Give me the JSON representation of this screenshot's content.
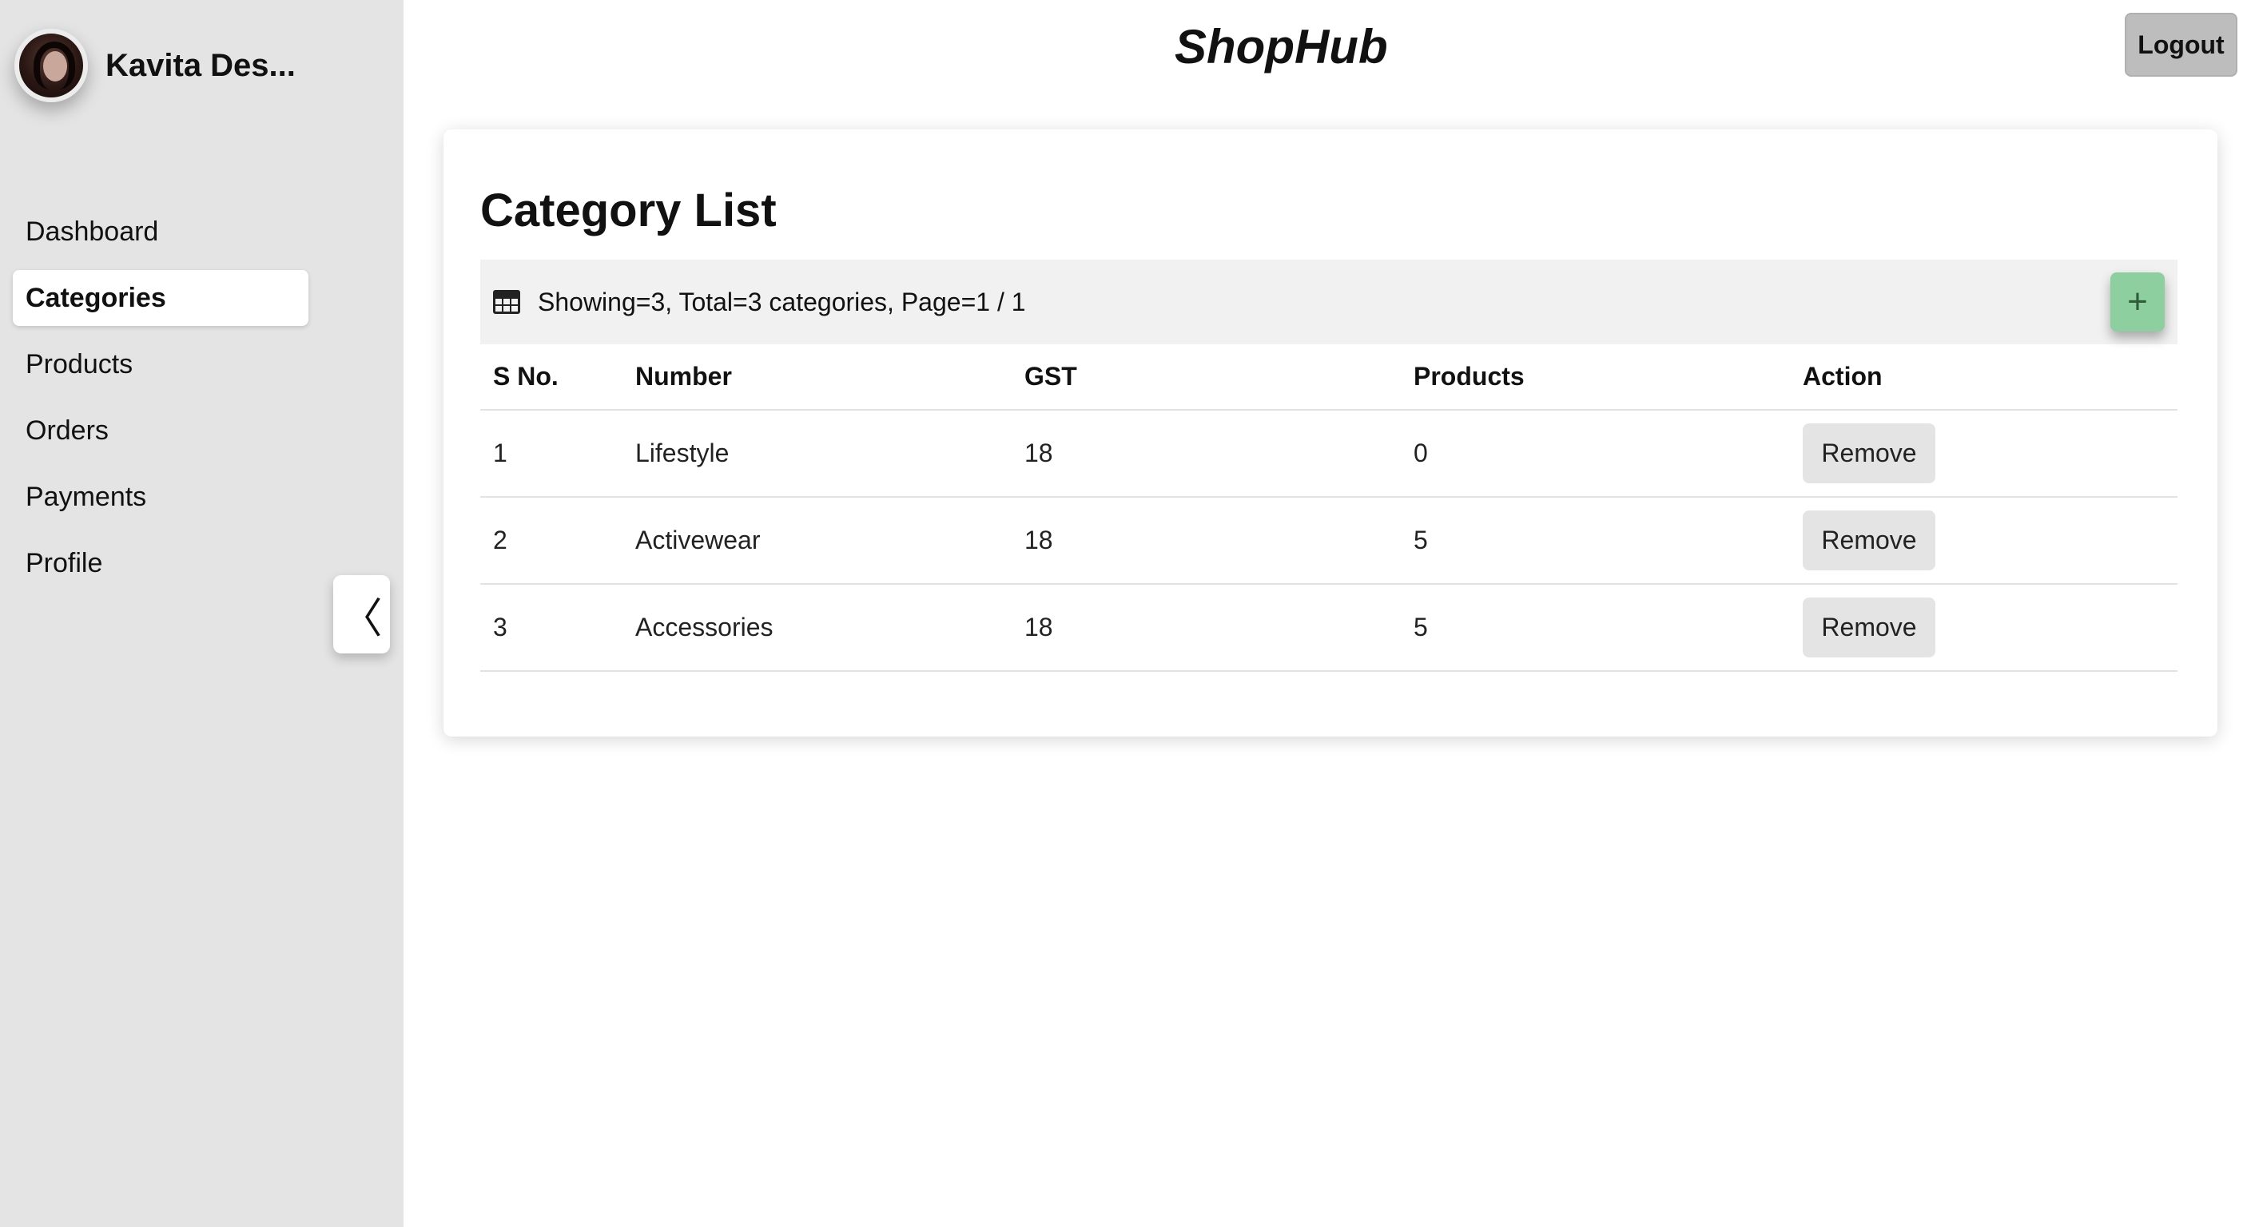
{
  "user": {
    "name": "Kavita Des..."
  },
  "nav": {
    "items": [
      {
        "label": "Dashboard",
        "active": false
      },
      {
        "label": "Categories",
        "active": true
      },
      {
        "label": "Products",
        "active": false
      },
      {
        "label": "Orders",
        "active": false
      },
      {
        "label": "Payments",
        "active": false
      },
      {
        "label": "Profile",
        "active": false
      }
    ],
    "collapse_glyph": "〈"
  },
  "header": {
    "brand": "ShopHub",
    "logout_label": "Logout"
  },
  "main": {
    "title": "Category List",
    "summary": "Showing=3, Total=3 categories, Page=1 / 1",
    "add_glyph": "+",
    "table": {
      "columns": [
        "S No.",
        "Number",
        "GST",
        "Products",
        "Action"
      ],
      "rows": [
        {
          "sno": "1",
          "number": "Lifestyle",
          "gst": "18",
          "products": "0",
          "action": "Remove"
        },
        {
          "sno": "2",
          "number": "Activewear",
          "gst": "18",
          "products": "5",
          "action": "Remove"
        },
        {
          "sno": "3",
          "number": "Accessories",
          "gst": "18",
          "products": "5",
          "action": "Remove"
        }
      ]
    }
  },
  "colors": {
    "sidebar_bg": "#e4e4e4",
    "add_button": "#8ecf9f",
    "logout_button": "#bdbdbd"
  }
}
